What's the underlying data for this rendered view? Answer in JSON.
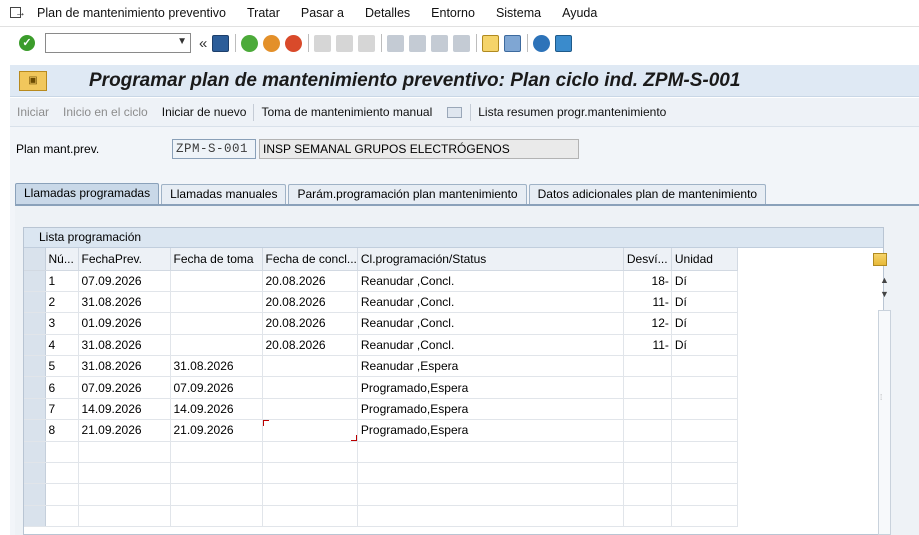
{
  "menu": {
    "items": [
      "Plan de mantenimiento preventivo",
      "Tratar",
      "Pasar a",
      "Detalles",
      "Entorno",
      "Sistema",
      "Ayuda"
    ]
  },
  "toolbar": {
    "command_value": "",
    "colors": {
      "ok": "#3b9c2b",
      "back": "#4caa3a",
      "exit": "#e3902a",
      "cancel": "#d94a2a"
    }
  },
  "title": "Programar plan de mantenimiento preventivo: Plan ciclo ind. ZPM-S-001",
  "app_toolbar": {
    "iniciar": "Iniciar",
    "inicio_ciclo": "Inicio en el ciclo",
    "iniciar_nuevo": "Iniciar de nuevo",
    "toma_manual": "Toma de mantenimiento manual",
    "lista_resumen": "Lista resumen progr.mantenimiento"
  },
  "plan": {
    "label": "Plan mant.prev.",
    "code": "ZPM-S-001",
    "description": "INSP SEMANAL GRUPOS ELECTRÓGENOS"
  },
  "tabs": [
    {
      "label": "Llamadas programadas",
      "active": true
    },
    {
      "label": "Llamadas manuales",
      "active": false
    },
    {
      "label": "Parám.programación plan mantenimiento",
      "active": false
    },
    {
      "label": "Datos adicionales plan de mantenimiento",
      "active": false
    }
  ],
  "table": {
    "title": "Lista programación",
    "columns": [
      "Nú...",
      "FechaPrev.",
      "Fecha de toma",
      "Fecha de concl...",
      "Cl.programación/Status",
      "Desví...",
      "Unidad"
    ],
    "rows": [
      [
        "1",
        "07.09.2026",
        "",
        "20.08.2026",
        "Reanudar  ,Concl.",
        "18-",
        "Dí"
      ],
      [
        "2",
        "31.08.2026",
        "",
        "20.08.2026",
        "Reanudar  ,Concl.",
        "11-",
        "Dí"
      ],
      [
        "3",
        "01.09.2026",
        "",
        "20.08.2026",
        "Reanudar  ,Concl.",
        "12-",
        "Dí"
      ],
      [
        "4",
        "31.08.2026",
        "",
        "20.08.2026",
        "Reanudar  ,Concl.",
        "11-",
        "Dí"
      ],
      [
        "5",
        "31.08.2026",
        "31.08.2026",
        "",
        "Reanudar  ,Espera",
        "",
        ""
      ],
      [
        "6",
        "07.09.2026",
        "07.09.2026",
        "",
        "Programado,Espera",
        "",
        ""
      ],
      [
        "7",
        "14.09.2026",
        "14.09.2026",
        "",
        "Programado,Espera",
        "",
        ""
      ],
      [
        "8",
        "21.09.2026",
        "21.09.2026",
        "",
        "Programado,Espera",
        "",
        ""
      ]
    ]
  }
}
